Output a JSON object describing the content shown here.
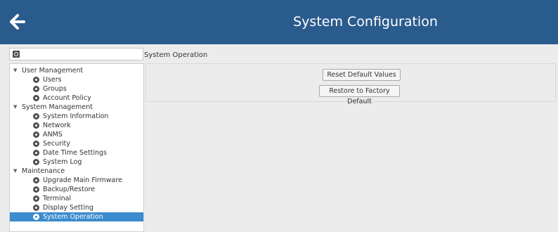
{
  "header": {
    "title": "System Configuration",
    "back_icon": "arrow-left-icon",
    "background": "#2a5b8d"
  },
  "sidebar": {
    "search_icon": "search-icon",
    "groups": [
      {
        "label": "User Management",
        "items": [
          {
            "label": "Users"
          },
          {
            "label": "Groups"
          },
          {
            "label": "Account Policy"
          }
        ]
      },
      {
        "label": "System Management",
        "items": [
          {
            "label": "System Information"
          },
          {
            "label": "Network"
          },
          {
            "label": "ANMS"
          },
          {
            "label": "Security"
          },
          {
            "label": "Date Time Settings"
          },
          {
            "label": "System Log"
          }
        ]
      },
      {
        "label": "Maintenance",
        "items": [
          {
            "label": "Upgrade Main Firmware"
          },
          {
            "label": "Backup/Restore"
          },
          {
            "label": "Terminal"
          },
          {
            "label": "Display Setting"
          },
          {
            "label": "System Operation",
            "selected": true
          }
        ]
      }
    ],
    "selected_color": "#3b8bce"
  },
  "content": {
    "section_title": "System Operation",
    "buttons": {
      "reset": "Reset Default Values",
      "restore": "Restore to Factory Default"
    }
  }
}
